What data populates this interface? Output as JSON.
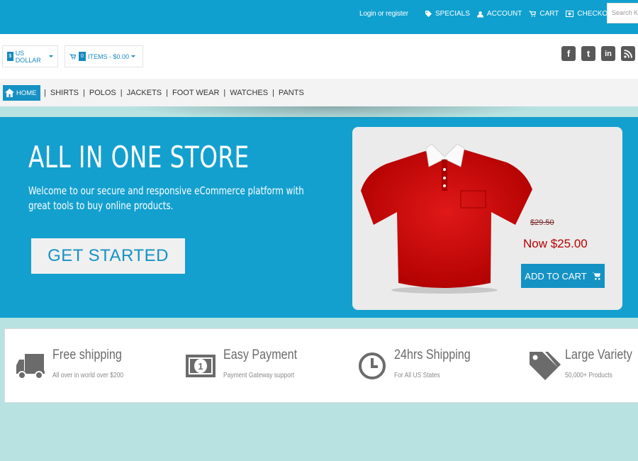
{
  "topbar": {
    "login": "Login or register",
    "nav": [
      {
        "label": "SPECIALS",
        "icon": "tag-icon"
      },
      {
        "label": "ACCOUNT",
        "icon": "user-icon"
      },
      {
        "label": "CART",
        "icon": "cart-icon"
      },
      {
        "label": "CHECKOUT",
        "icon": "checkout-icon"
      }
    ],
    "search_placeholder": "Search Ke"
  },
  "bar2": {
    "currency_symbol": "$",
    "currency_label": "US DOLLAR",
    "cart_count": "0",
    "cart_label": "ITEMS - $0.00"
  },
  "social": [
    "facebook-icon",
    "twitter-icon",
    "linkedin-icon",
    "rss-icon"
  ],
  "menu": {
    "home": "HOME",
    "items": [
      "SHIRTS",
      "POLOS",
      "JACKETS",
      "FOOT WEAR",
      "WATCHES",
      "PANTS"
    ]
  },
  "hero": {
    "title": "ALL IN ONE STORE",
    "description": "Welcome to our secure and responsive eCommerce platform with great tools to buy online products.",
    "cta": "GET STARTED"
  },
  "product": {
    "old_price": "$29.50",
    "new_price": "Now $25.00",
    "add_to_cart": "ADD TO CART",
    "shirt_color": "#cc0a0a"
  },
  "features": [
    {
      "title": "Free shipping",
      "subtitle": "All over in world over $200",
      "icon": "truck-icon"
    },
    {
      "title": "Easy Payment",
      "subtitle": "Payment Gateway support",
      "icon": "money-icon"
    },
    {
      "title": "24hrs Shipping",
      "subtitle": "For All US States",
      "icon": "clock-icon"
    },
    {
      "title": "Large Variety",
      "subtitle": "50,000+ Products",
      "icon": "tags-icon"
    }
  ],
  "colors": {
    "primary": "#13a0cf",
    "accent_red": "#b90000",
    "footer_bg": "#b8e2e2"
  }
}
